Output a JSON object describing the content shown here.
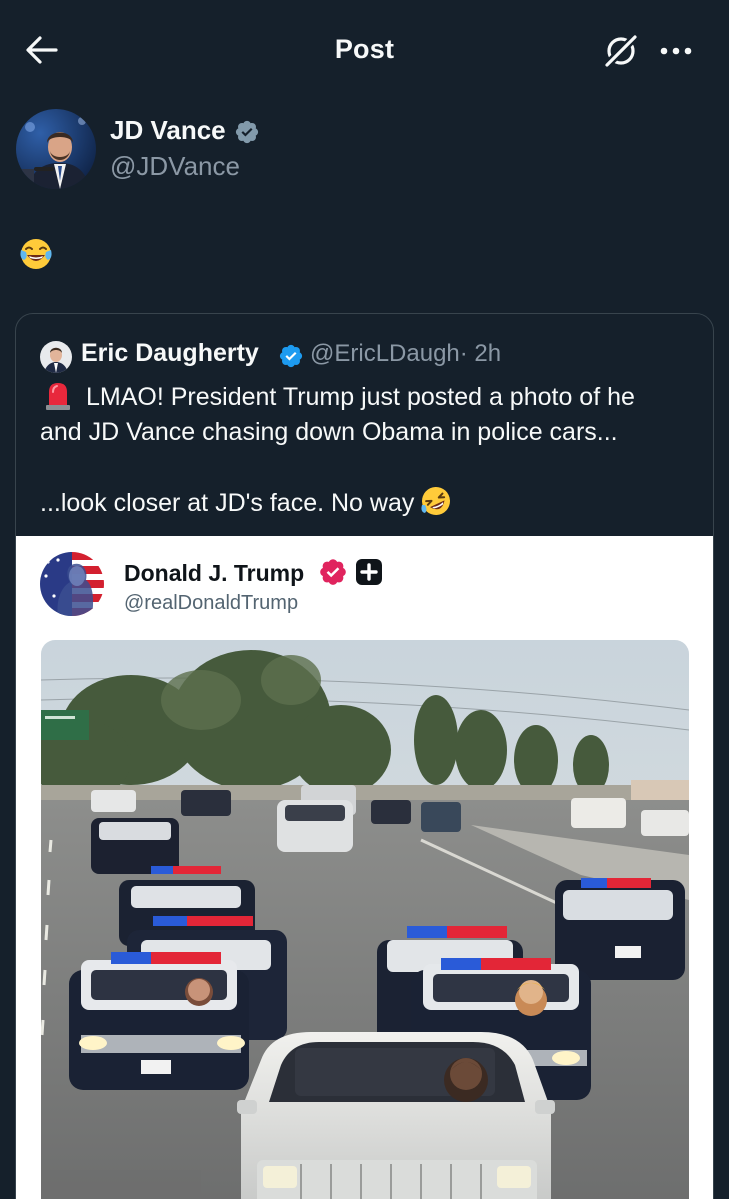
{
  "header": {
    "title": "Post"
  },
  "author": {
    "name": "JD Vance",
    "handle": "@JDVance"
  },
  "post": {
    "emoji": "face with tears of joy"
  },
  "quoted_post": {
    "name": "Eric Daugherty",
    "handle": "@EricLDaugh",
    "time": "· 2h",
    "line1": "LMAO! President Trump just posted a photo of he",
    "line2": "and JD Vance chasing down Obama in police cars...",
    "line3": "...look closer at JD's face. No way",
    "embedded": {
      "name": "Donald J. Trump",
      "handle": "@realDonaldTrump"
    }
  },
  "icons": {
    "back": "arrow-left-icon",
    "grok": "grok-icon",
    "more": "more-icon",
    "verified": "verified-badge-icon",
    "siren": "siren-emoji",
    "rofl": "rofl-emoji"
  },
  "colors": {
    "background": "#15202b",
    "text": "#f7f9f9",
    "secondary_text": "#8b98a5",
    "border": "#38444d",
    "verified_blue": "#1d9bf0",
    "verified_gray": "#829aab",
    "verified_pink": "#e0245e"
  }
}
